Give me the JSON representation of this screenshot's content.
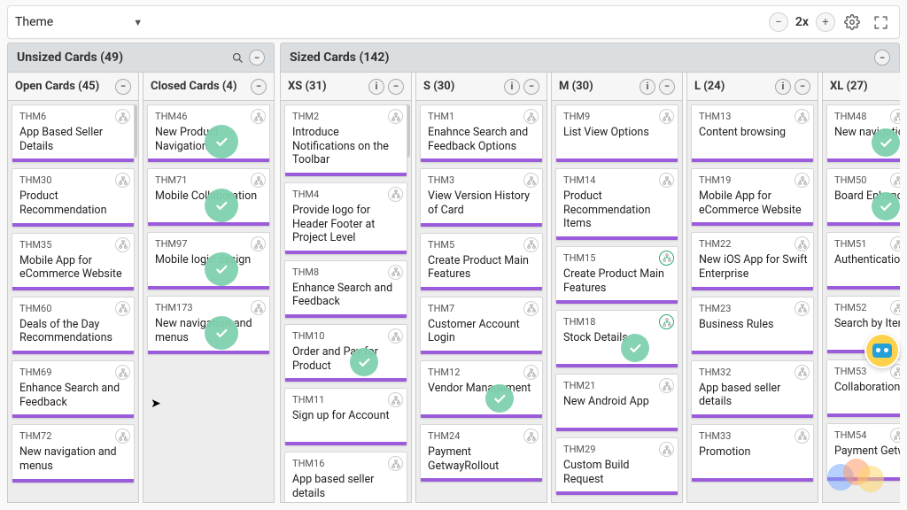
{
  "toolbar": {
    "selector_label": "Theme",
    "zoom_label": "2x"
  },
  "groups": {
    "unsized_label": "Unsized Cards (49)",
    "sized_label": "Sized Cards (142)"
  },
  "columns": {
    "open": {
      "label": "Open Cards (45)"
    },
    "closed": {
      "label": "Closed Cards (4)"
    },
    "xs": {
      "label": "XS (31)"
    },
    "s": {
      "label": "S (30)"
    },
    "m": {
      "label": "M (30)"
    },
    "l": {
      "label": "L (24)"
    },
    "xl": {
      "label": "XL (27)"
    }
  },
  "cards": {
    "open": [
      {
        "id": "THM6",
        "title": "App Based Seller Details"
      },
      {
        "id": "THM30",
        "title": "Product Recommendation"
      },
      {
        "id": "THM35",
        "title": "Mobile App for eCommerce Website"
      },
      {
        "id": "THM60",
        "title": "Deals of the Day Recommendations"
      },
      {
        "id": "THM69",
        "title": "Enhance Search and Feedback"
      },
      {
        "id": "THM72",
        "title": "New navigation and menus"
      }
    ],
    "closed": [
      {
        "id": "THM46",
        "title": "New Product Navigation",
        "done": true
      },
      {
        "id": "THM71",
        "title": "Mobile Collaboration",
        "done": true
      },
      {
        "id": "THM97",
        "title": "Mobile login design",
        "done": true
      },
      {
        "id": "THM173",
        "title": "New navigation and menus",
        "done": true
      }
    ],
    "xs": [
      {
        "id": "THM2",
        "title": "Introduce Notifications on the Toolbar"
      },
      {
        "id": "THM4",
        "title": "Provide logo for Header Footer at Project Level"
      },
      {
        "id": "THM8",
        "title": "Enhance Search and Feedback"
      },
      {
        "id": "THM10",
        "title": "Order and Pay for Product",
        "done": true,
        "small": true
      },
      {
        "id": "THM11",
        "title": "Sign up for Account"
      },
      {
        "id": "THM16",
        "title": "App based seller details"
      }
    ],
    "s": [
      {
        "id": "THM1",
        "title": "Enahnce Search and Feedback Options"
      },
      {
        "id": "THM3",
        "title": "View Version History of Card"
      },
      {
        "id": "THM5",
        "title": "Create Product Main Features"
      },
      {
        "id": "THM7",
        "title": "Customer Account Login"
      },
      {
        "id": "THM12",
        "title": "Vendor Management",
        "done": true,
        "small": true
      },
      {
        "id": "THM24",
        "title": "Payment GetwayRollout"
      }
    ],
    "m": [
      {
        "id": "THM9",
        "title": "List View Options"
      },
      {
        "id": "THM14",
        "title": "Product Recommendation Items"
      },
      {
        "id": "THM15",
        "title": "Create Product Main Features",
        "greenbadge": true
      },
      {
        "id": "THM18",
        "title": "Stock Details",
        "done": true,
        "greenbadge": true,
        "small": true
      },
      {
        "id": "THM21",
        "title": "New Android App"
      },
      {
        "id": "THM29",
        "title": "Custom Build Request"
      }
    ],
    "l": [
      {
        "id": "THM13",
        "title": "Content browsing"
      },
      {
        "id": "THM19",
        "title": "Mobile App for eCommerce Website"
      },
      {
        "id": "THM22",
        "title": "New iOS App for Swift Enterprise"
      },
      {
        "id": "THM23",
        "title": "Business Rules"
      },
      {
        "id": "THM32",
        "title": "App based seller details"
      },
      {
        "id": "THM33",
        "title": "Promotion"
      }
    ],
    "xl": [
      {
        "id": "THM48",
        "title": "New navigation and menus",
        "done": true,
        "small": true
      },
      {
        "id": "THM50",
        "title": "Board Enhancements",
        "done": true,
        "small": true
      },
      {
        "id": "THM51",
        "title": "Authentication Software"
      },
      {
        "id": "THM52",
        "title": "Search by Itemtype"
      },
      {
        "id": "THM53",
        "title": "Collaboration"
      },
      {
        "id": "THM54",
        "title": "Payment Getway Rollout Mobile"
      }
    ]
  }
}
